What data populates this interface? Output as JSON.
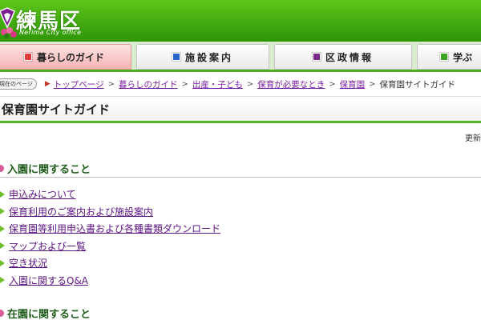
{
  "header": {
    "logo_text": "練馬区",
    "logo_sub": "Nerima City office"
  },
  "nav": {
    "tabs": [
      {
        "label": "暮らしのガイド",
        "color": "#e23b3b"
      },
      {
        "label": "施設案内",
        "color": "#2a66c9"
      },
      {
        "label": "区政情報",
        "color": "#7b2a8c"
      },
      {
        "label": "学ぶ",
        "color": "#3aa521"
      }
    ]
  },
  "breadcrumb": {
    "label": "現在のページ",
    "items": [
      "トップページ",
      "暮らしのガイド",
      "出産・子ども",
      "保育が必要なとき",
      "保育園"
    ],
    "current": "保育園サイトガイド"
  },
  "page": {
    "title": "保育園サイトガイド",
    "updated": "更新"
  },
  "sections": [
    {
      "heading": "入園に関すること",
      "links": [
        "申込みについて",
        "保育利用のご案内および施設案内",
        "保育園等利用申込書および各種書類ダウンロード",
        "マップおよび一覧",
        "空き状況",
        "入園に関するQ&A"
      ]
    },
    {
      "heading": "在園に関すること",
      "links": []
    }
  ]
}
